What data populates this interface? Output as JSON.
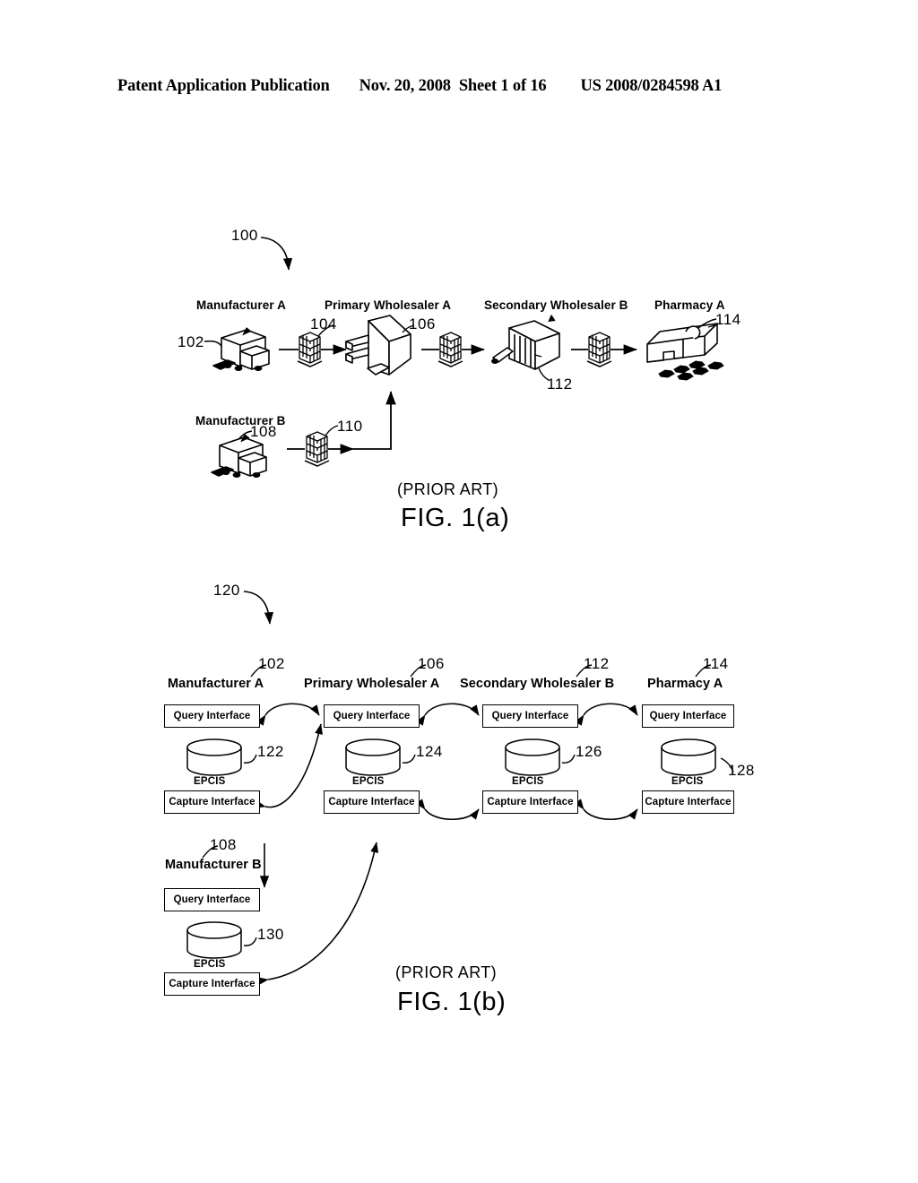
{
  "header": {
    "publication": "Patent Application Publication",
    "date": "Nov. 20, 2008",
    "sheet": "Sheet 1 of 16",
    "patent_number": "US 2008/0284598 A1"
  },
  "figures": [
    {
      "id": "fig-1a",
      "system_ref": "100",
      "prior_art": "(PRIOR ART)",
      "caption": "FIG. 1(a)",
      "nodes": [
        {
          "label": "Manufacturer A",
          "ref": "102",
          "icon": "factory-truck-icon"
        },
        {
          "label": "Primary Wholesaler A",
          "ref": "106",
          "icon": "warehouse-icon"
        },
        {
          "label": "Secondary Wholesaler B",
          "ref": "112",
          "icon": "warehouse-icon"
        },
        {
          "label": "Pharmacy A",
          "ref": "114",
          "icon": "pharmacy-building-icon"
        },
        {
          "label": "Manufacturer B",
          "ref": "108",
          "icon": "factory-truck-icon"
        }
      ],
      "pallets": [
        {
          "ref": "104",
          "icon": "pallet-icon"
        },
        {
          "ref": "110",
          "icon": "pallet-icon"
        }
      ]
    },
    {
      "id": "fig-1b",
      "system_ref": "120",
      "prior_art": "(PRIOR ART)",
      "caption": "FIG. 1(b)",
      "query_label": "Query Interface",
      "capture_label": "Capture Interface",
      "epcis_label": "EPCIS",
      "columns": [
        {
          "label": "Manufacturer A",
          "ref": "102",
          "epcis_ref": "122"
        },
        {
          "label": "Primary Wholesaler A",
          "ref": "106",
          "epcis_ref": "124"
        },
        {
          "label": "Secondary Wholesaler B",
          "ref": "112",
          "epcis_ref": "126"
        },
        {
          "label": "Pharmacy A",
          "ref": "114",
          "epcis_ref": "128"
        },
        {
          "label": "Manufacturer B",
          "ref": "108",
          "epcis_ref": "130"
        }
      ]
    }
  ]
}
